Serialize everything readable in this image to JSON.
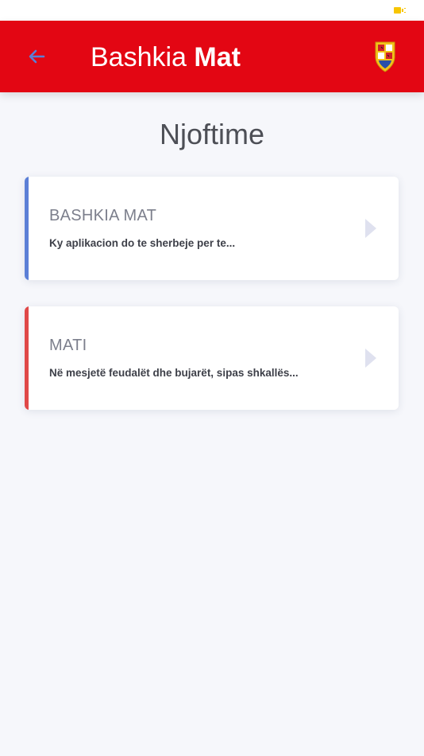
{
  "header": {
    "title_regular": "Bashkia ",
    "title_bold": "Mat"
  },
  "page": {
    "title": "Njoftime"
  },
  "cards": [
    {
      "title": "BASHKIA MAT",
      "text": "Ky aplikacion do te sherbeje per te...",
      "accent_color": "#5b7fd6"
    },
    {
      "title": "MATI",
      "text": "Në mesjetë feudalët dhe bujarët, sipas shkallës...",
      "accent_color": "#e04848"
    }
  ],
  "colors": {
    "header_bg": "#e30613",
    "back_arrow": "#5b7fd6",
    "battery": "#f7c500",
    "card_arrow": "#dfe1ef"
  },
  "icons": {
    "back": "arrow-left-icon",
    "crest": "crest-icon",
    "card_arrow": "chevron-right-icon",
    "battery": "battery-icon"
  }
}
